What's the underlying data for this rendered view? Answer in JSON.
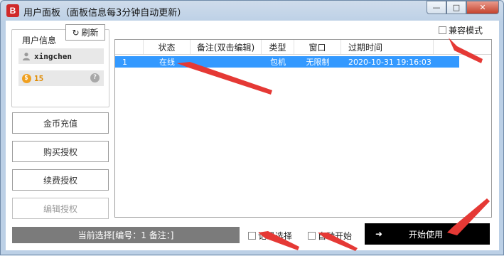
{
  "window": {
    "icon_letter": "B",
    "title": "用户面板（面板信息每3分钟自动更新）",
    "minimize_glyph": "—",
    "maximize_glyph": "□",
    "close_glyph": "✕"
  },
  "user_info": {
    "group_label": "用户信息",
    "refresh_label": "刷新",
    "username": "xingchen",
    "coins": "15",
    "help_glyph": "?"
  },
  "side_buttons": [
    {
      "label": "金币充值"
    },
    {
      "label": "购买授权"
    },
    {
      "label": "续费授权"
    },
    {
      "label": "编辑授权"
    }
  ],
  "compat_mode_label": "兼容模式",
  "table": {
    "columns": [
      "",
      "状态",
      "备注(双击编辑)",
      "类型",
      "窗口",
      "过期时间"
    ],
    "rows": [
      [
        "1",
        "在线",
        "",
        "包机",
        "无限制",
        "2020-10-31 19:16:03"
      ]
    ]
  },
  "status_text": "当前选择[编号：1 备注：]",
  "record_select_label": "记录选择",
  "auto_start_label": "自动开始",
  "start_button_label": "开始使用",
  "colors": {
    "selection": "#3399ff",
    "annotation_arrow": "#e53935",
    "start_button": "#000000"
  }
}
